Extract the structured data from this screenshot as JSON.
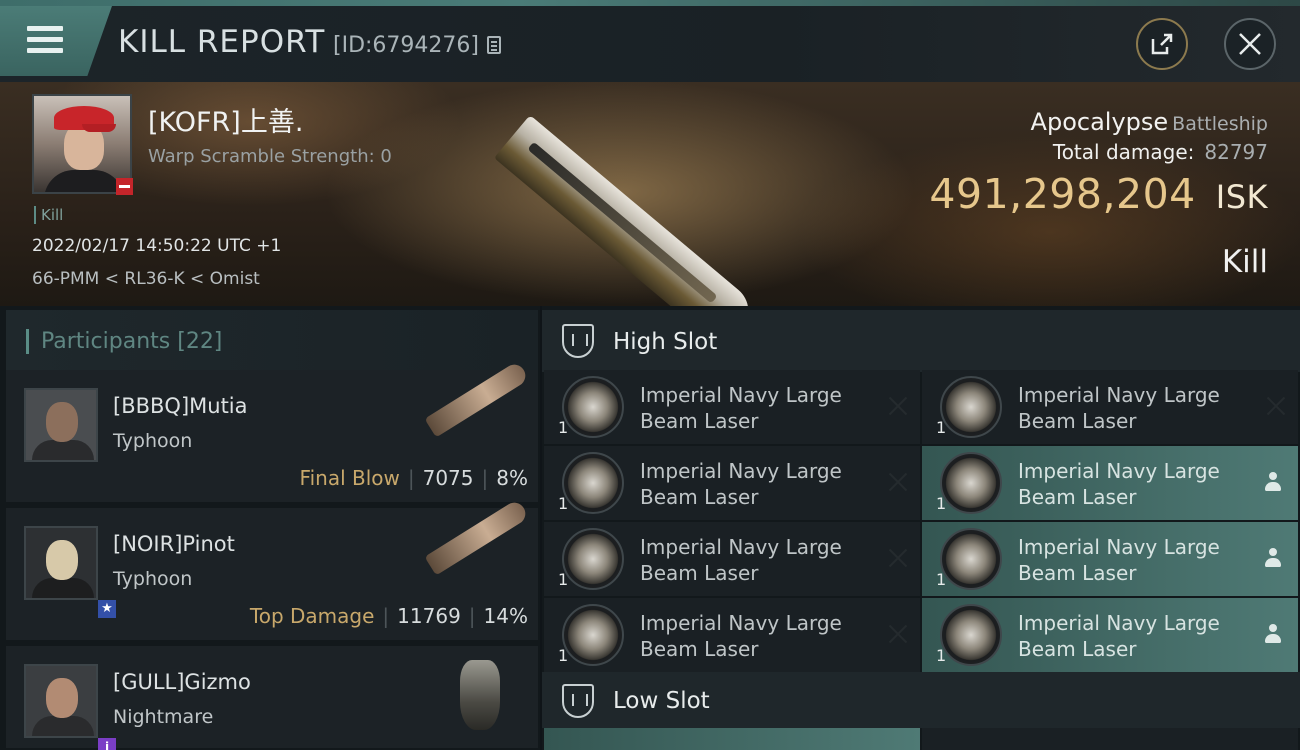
{
  "header": {
    "title": "KILL REPORT",
    "report_id": "[ID:6794276]"
  },
  "victim": {
    "name": "[KOFR]上善.",
    "warp_scramble": "Warp Scramble Strength: 0",
    "kill_tag": "Kill",
    "timestamp": "2022/02/17 14:50:22 UTC +1",
    "location": "66-PMM < RL36-K < Omist",
    "ship_name": "Apocalypse",
    "ship_class": "Battleship",
    "total_damage_label": "Total damage:",
    "total_damage_value": "82797",
    "isk_value": "491,298,204",
    "isk_unit": "ISK",
    "result": "Kill"
  },
  "participants": {
    "label": "Participants",
    "count": "[22]",
    "rows": [
      {
        "name": "[BBBQ]Mutia",
        "ship": "Typhoon",
        "tag": "Final Blow",
        "damage": "7075",
        "percent": "8%"
      },
      {
        "name": "[NOIR]Pinot",
        "ship": "Typhoon",
        "tag": "Top Damage",
        "damage": "11769",
        "percent": "14%"
      },
      {
        "name": "[GULL]Gizmo",
        "ship": "Nightmare",
        "tag": "",
        "damage": "",
        "percent": ""
      }
    ]
  },
  "slots": {
    "high_label": "High Slot",
    "low_label": "Low Slot",
    "high_modules": [
      {
        "name": "Imperial Navy Large Beam Laser",
        "qty": "1",
        "status": "destroyed"
      },
      {
        "name": "Imperial Navy Large Beam Laser",
        "qty": "1",
        "status": "destroyed"
      },
      {
        "name": "Imperial Navy Large Beam Laser",
        "qty": "1",
        "status": "destroyed"
      },
      {
        "name": "Imperial Navy Large Beam Laser",
        "qty": "1",
        "status": "dropped"
      },
      {
        "name": "Imperial Navy Large Beam Laser",
        "qty": "1",
        "status": "destroyed"
      },
      {
        "name": "Imperial Navy Large Beam Laser",
        "qty": "1",
        "status": "dropped"
      },
      {
        "name": "Imperial Navy Large Beam Laser",
        "qty": "1",
        "status": "destroyed"
      },
      {
        "name": "Imperial Navy Large Beam Laser",
        "qty": "1",
        "status": "dropped"
      }
    ]
  },
  "icons": {
    "menu": "hamburger-icon",
    "share": "share-icon",
    "close": "close-icon",
    "copy": "copy-icon",
    "destroyed": "x-icon",
    "dropped": "person-icon"
  },
  "colors": {
    "accent": "#4f7a75",
    "isk": "#e6c78c",
    "tag": "#c8a86b"
  }
}
